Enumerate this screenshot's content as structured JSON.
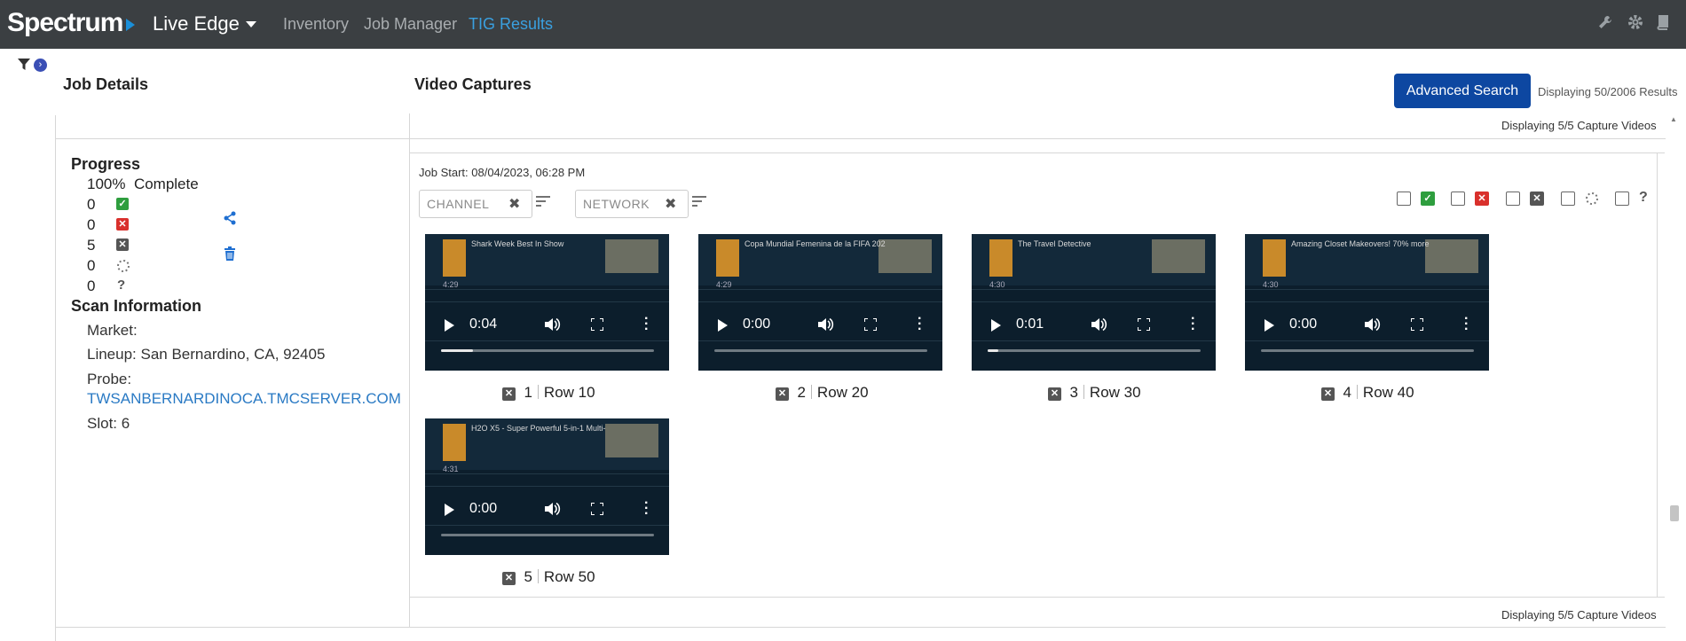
{
  "nav": {
    "brand": "Spectrum",
    "selector": "Live Edge",
    "links": [
      "Inventory",
      "Job Manager",
      "TIG Results"
    ],
    "active_link": "TIG Results",
    "icons": [
      "wrench-icon",
      "gear-icon",
      "book-icon"
    ]
  },
  "headings": {
    "job_details": "Job Details",
    "video_captures": "Video Captures"
  },
  "toolbar": {
    "advanced_search": "Advanced Search",
    "displaying_results": "Displaying 50/2006 Results",
    "displaying_captures_top": "Displaying 5/5 Capture Videos",
    "displaying_captures_bottom": "Displaying 5/5 Capture Videos"
  },
  "progress": {
    "title": "Progress",
    "percent": "100%",
    "complete_label": "Complete",
    "rows": [
      {
        "count": "0",
        "status": "passed"
      },
      {
        "count": "0",
        "status": "failed"
      },
      {
        "count": "5",
        "status": "no-result"
      },
      {
        "count": "0",
        "status": "pending"
      },
      {
        "count": "0",
        "status": "unknown"
      }
    ]
  },
  "scan": {
    "title": "Scan Information",
    "market": "Market:",
    "lineup": "Lineup: San Bernardino, CA, 92405",
    "probe_label": "Probe:",
    "probe_value": "TWSANBERNARDINOCA.TMCSERVER.COM",
    "slot": "Slot: 6"
  },
  "captures": {
    "job_start": "Job Start: 08/04/2023, 06:28 PM",
    "filters": [
      {
        "placeholder": "CHANNEL"
      },
      {
        "placeholder": "NETWORK"
      }
    ],
    "status_toggle_colors": {
      "passed": "#2e9e3e",
      "failed": "#d9302c",
      "no_result": "#555555"
    },
    "videos": [
      {
        "index": "1",
        "row": "Row 10",
        "time": "0:04",
        "title": "Shark Week Best In Show",
        "guide_time": "4:29",
        "progress": 0.15
      },
      {
        "index": "2",
        "row": "Row 20",
        "time": "0:00",
        "title": "Copa Mundial Femenina de la FIFA 202",
        "guide_time": "4:29",
        "progress": 0.0
      },
      {
        "index": "3",
        "row": "Row 30",
        "time": "0:01",
        "title": "The Travel Detective",
        "guide_time": "4:30",
        "progress": 0.05
      },
      {
        "index": "4",
        "row": "Row 40",
        "time": "0:00",
        "title": "Amazing Closet Makeovers! 70% more",
        "guide_time": "4:30",
        "progress": 0.0
      },
      {
        "index": "5",
        "row": "Row 50",
        "time": "0:00",
        "title": "H2O X5 - Super Powerful 5-in-1 Multi-",
        "guide_time": "4:31",
        "progress": 0.0
      }
    ]
  }
}
